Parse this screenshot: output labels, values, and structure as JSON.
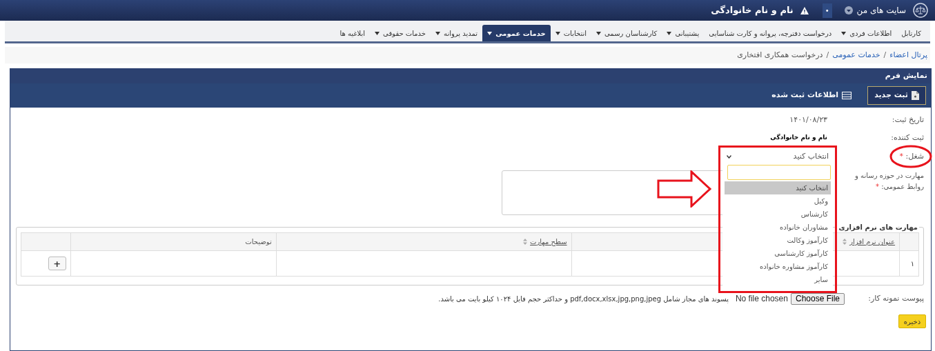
{
  "topbar": {
    "sites_menu": "سایت های من",
    "counter": "•",
    "user_name": "نام و نام خانوادگی"
  },
  "nav": [
    {
      "label": "کارتابل",
      "has_menu": false,
      "selected": false
    },
    {
      "label": "اطلاعات فردی",
      "has_menu": true,
      "selected": false
    },
    {
      "label": "درخواست دفترچه، پروانه و کارت شناسایی",
      "has_menu": false,
      "selected": false
    },
    {
      "label": "پشتیبانی",
      "has_menu": true,
      "selected": false
    },
    {
      "label": "کارشناسان رسمی",
      "has_menu": true,
      "selected": false
    },
    {
      "label": "انتخابات",
      "has_menu": true,
      "selected": false
    },
    {
      "label": "خدمات عمومی",
      "has_menu": true,
      "selected": true
    },
    {
      "label": "تمدید پروانه",
      "has_menu": true,
      "selected": false
    },
    {
      "label": "خدمات حقوقی",
      "has_menu": true,
      "selected": false
    },
    {
      "label": "ابلاغیه ها",
      "has_menu": false,
      "selected": false
    }
  ],
  "breadcrumb": [
    {
      "label": "پرتال اعضاء",
      "link": true
    },
    {
      "label": "خدمات عمومی",
      "link": true
    },
    {
      "label": "درخواست همکاری افتخاری",
      "link": false
    }
  ],
  "breadcrumb_separator": "/",
  "panel": {
    "title": "نمایش فرم",
    "toolbar": [
      {
        "label": "ثبت جدید",
        "selected": true
      },
      {
        "label": "اطلاعات ثبت شده",
        "selected": false
      }
    ]
  },
  "form": {
    "registration_date": {
      "label": "تاریخ ثبت:",
      "value": "۱۴۰۱/۰۸/۲۳"
    },
    "registrant": {
      "label": "ثبت کننده:",
      "value": "نام و نام خانوادگی"
    },
    "job": {
      "label": "شغل:",
      "required_mark": "*",
      "value": "انتخاب کنید",
      "expanded": true,
      "options": [
        {
          "label": "انتخاب کنید",
          "selected": true
        },
        {
          "label": "وکیل",
          "selected": false
        },
        {
          "label": "کارشناس",
          "selected": false
        },
        {
          "label": "مشاوران خانواده",
          "selected": false
        },
        {
          "label": "کارآموز وکالت",
          "selected": false
        },
        {
          "label": "کارآموز کارشناسی",
          "selected": false
        },
        {
          "label": "کارآموز مشاوره خانواده",
          "selected": false
        },
        {
          "label": "سایر",
          "selected": false
        }
      ]
    },
    "media_skill": {
      "label": "مهارت در حوزه رسانه و روابط عمومی:",
      "required_mark": "*"
    }
  },
  "software_skills": {
    "title": "مهارت های نرم افزاری",
    "columns": [
      {
        "sortable": false
      },
      {
        "label": "عنوان نرم افزار",
        "sortable": true
      },
      {
        "sortable": false
      },
      {
        "label": "سطح مهارت",
        "sortable": true
      },
      {
        "label": "توضیحات",
        "sortable": false
      }
    ],
    "rows": [
      {
        "number": "۱"
      }
    ],
    "add_button": "+"
  },
  "attachment": {
    "label": "پیوست نمونه کار:",
    "button": "Choose File",
    "status": "No file chosen",
    "hint": "پسوند های مجاز شامل pdf,docx,xlsx,jpg,png,jpeg و حداکثر حجم فایل ۱۰۲۴ کیلو بایت می باشد."
  },
  "save_button": "ذخیره"
}
